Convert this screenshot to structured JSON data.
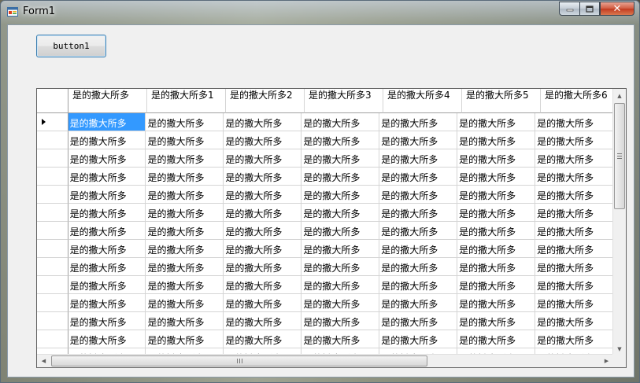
{
  "window": {
    "title": "Form1",
    "close_glyph": "✕"
  },
  "toolbar": {
    "button1_label": "button1"
  },
  "grid": {
    "columns": [
      "是的撒大所多",
      "是的撒大所多1",
      "是的撒大所多2",
      "是的撒大所多3",
      "是的撒大所多4",
      "是的撒大所多5",
      "是的撒大所多6"
    ],
    "cell_text": "是的撒大所多",
    "visible_rows": 14,
    "selected_row": 0,
    "selected_col": 0
  },
  "icons": {
    "app": "form-icon",
    "current_row": "row-indicator-arrow-icon"
  }
}
